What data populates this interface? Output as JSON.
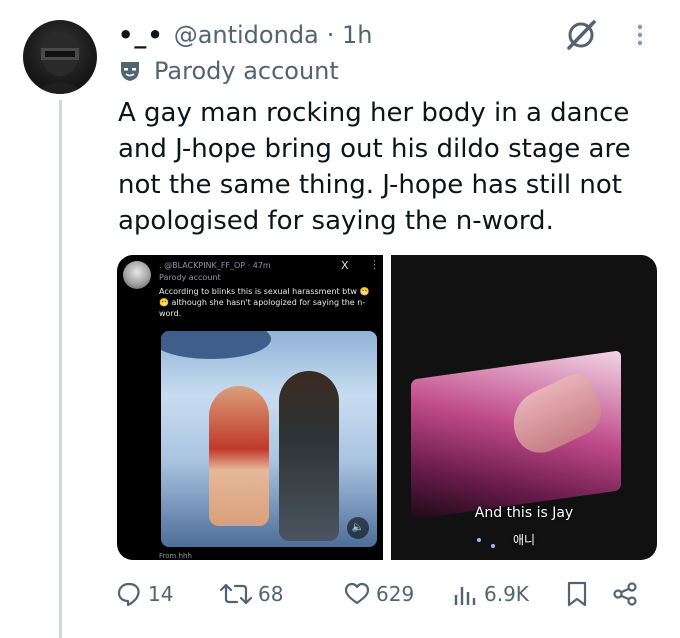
{
  "tweet": {
    "display_name": "•_•",
    "handle": "@antidonda",
    "time": "· 1h",
    "parody_label": "Parody account",
    "text": "A gay man rocking her body in a dance and J-hope bring out his dildo stage are not the same thing. J-hope has still not apologised for saying the n-word."
  },
  "embedded": {
    "header": ". @BLACKPINK_FF_OP · 47m",
    "x_label": "X",
    "dots": "⋮",
    "parody_label": "Parody account",
    "text": "According to blinks this is sexual harassment btw 😬😬 although she hasn't apologized for saying the n-word.",
    "from_label": "From hhh",
    "mute_icon": "🔈"
  },
  "video": {
    "subtitle": "And this is Jay",
    "subtitle_korean": "애니"
  },
  "actions": {
    "replies": "14",
    "reposts": "68",
    "likes": "629",
    "views": "6.9K"
  },
  "colors": {
    "text": "#0f1419",
    "muted": "#536471",
    "thread_line": "#cfd9de"
  }
}
